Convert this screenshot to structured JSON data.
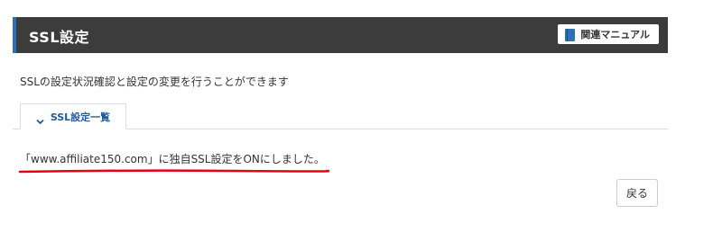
{
  "header": {
    "title": "SSL設定",
    "manual_label": "関連マニュアル"
  },
  "description": "SSLの設定状況確認と設定の変更を行うことができます",
  "tab": {
    "label": "SSL設定一覧"
  },
  "message": "「www.affiliate150.com」に独自SSL設定をONにしました。",
  "back_label": "戻る",
  "colors": {
    "header_bg": "#3c3c3c",
    "accent": "#2f6fb3",
    "link": "#1f5c99",
    "highlight": "#e60012"
  },
  "icons": {
    "manual": "book-icon",
    "tab": "chevron-down-icon"
  }
}
